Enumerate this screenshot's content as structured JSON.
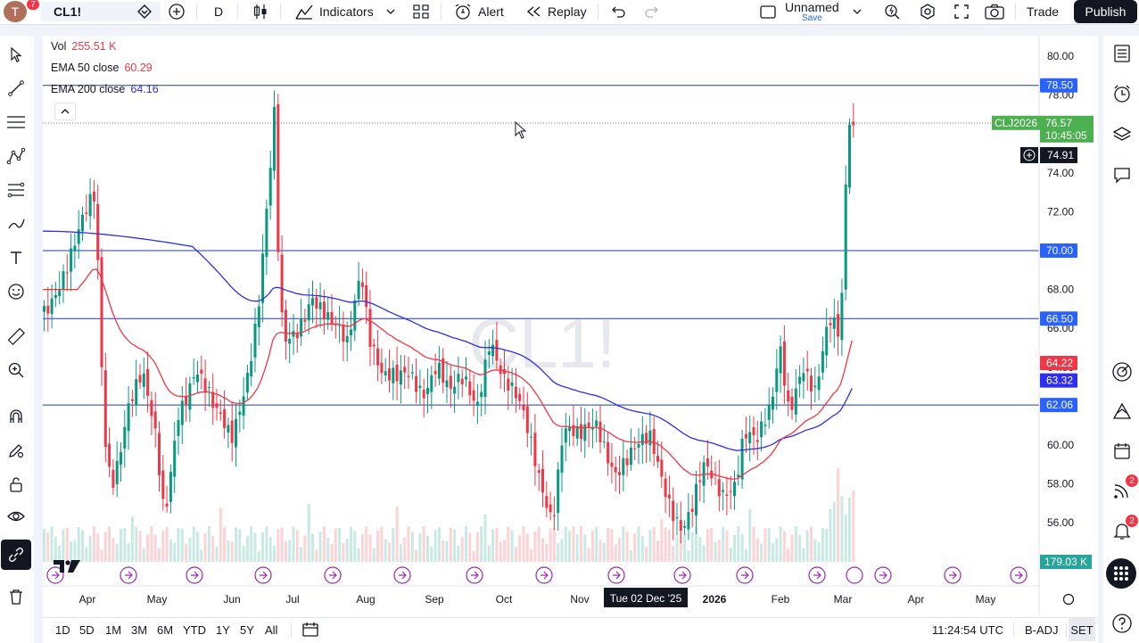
{
  "toolbar": {
    "avatar_letter": "T",
    "avatar_badge": "7",
    "symbol": "CL1!",
    "interval": "D",
    "indicators_label": "Indicators",
    "alert_label": "Alert",
    "replay_label": "Replay",
    "layout_name": "Unnamed",
    "layout_save": "Save",
    "trade_label": "Trade",
    "publish_label": "Publish"
  },
  "legend": {
    "vol_name": "Vol",
    "vol_value": "255.51 K",
    "ema50_name": "EMA 50 close",
    "ema50_value": "60.29",
    "ema200_name": "EMA 200 close",
    "ema200_value": "64.16"
  },
  "watermark": "CL1!",
  "price_axis": {
    "ticks": [
      "80.00",
      "78.00",
      "76.00",
      "74.00",
      "72.00",
      "70.00",
      "68.00",
      "66.00",
      "64.00",
      "62.00",
      "60.00",
      "58.00",
      "56.00"
    ],
    "labels": {
      "hline_78_50": "78.50",
      "contract": "CLJ2026",
      "last_price": "76.57",
      "countdown": "10:45:05",
      "crosshair": "74.91",
      "hline_70": "70.00",
      "hline_66_50": "66.50",
      "ema50": "64.22",
      "ema200": "63.32",
      "hline_62_06": "62.06",
      "volume": "179.03 K"
    }
  },
  "time_axis": {
    "labels": [
      "Apr",
      "May",
      "Jun",
      "Jul",
      "Aug",
      "Sep",
      "Oct",
      "Nov",
      "2026",
      "Feb",
      "Mar",
      "Apr",
      "May"
    ],
    "crosshair_date": "Tue 02 Dec '25"
  },
  "bottom": {
    "ranges": [
      "1D",
      "5D",
      "1M",
      "3M",
      "6M",
      "YTD",
      "1Y",
      "5Y",
      "All"
    ],
    "clock": "11:24:54 UTC",
    "badj": "B-ADJ",
    "set": "SET"
  },
  "rightbar": {
    "badge_1": "2",
    "badge_2": "2"
  },
  "colors": {
    "up": "#089981",
    "down": "#f23645",
    "ema50": "#f23645",
    "ema200": "#2e2ef0",
    "hline": "#1e3fa0",
    "label_blue": "#2962ff",
    "last_price": "#4caf50"
  },
  "chart_data": {
    "type": "candlestick",
    "symbol": "CL1!",
    "interval": "D",
    "horizontal_levels": [
      78.5,
      70.0,
      66.5,
      62.06
    ],
    "ema50_last": 64.22,
    "ema200_last": 63.32,
    "last_price": 76.57,
    "y_range": [
      54.5,
      80.5
    ]
  }
}
